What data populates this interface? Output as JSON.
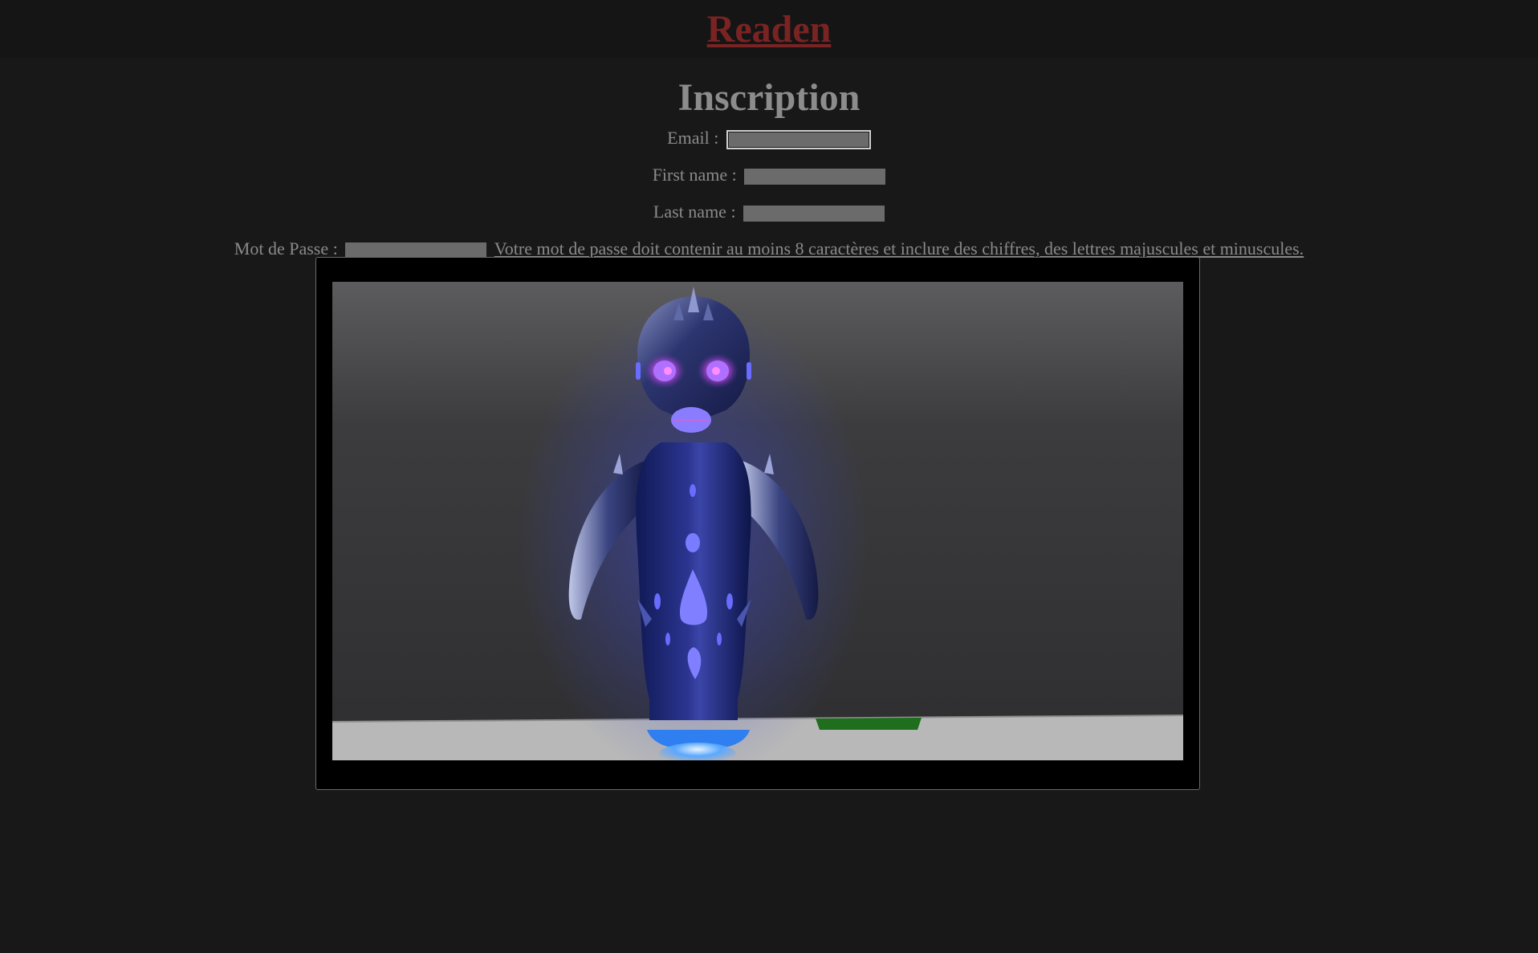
{
  "header": {
    "site_name": "Readen",
    "accent_color": "#7a2323"
  },
  "page": {
    "title": "Inscription"
  },
  "form": {
    "email_label": "Email :",
    "email_value": "",
    "first_name_label": "First name :",
    "first_name_value": "",
    "last_name_label": "Last name :",
    "last_name_value": "",
    "password_label": "Mot de Passe :",
    "password_value": "",
    "password_hint": "Votre mot de passe doit contenir au moins 8 caractères et inclure des chiffres, des lettres majuscules et minuscules."
  },
  "media": {
    "scene_icon": "glowing-robot-3d-render"
  }
}
